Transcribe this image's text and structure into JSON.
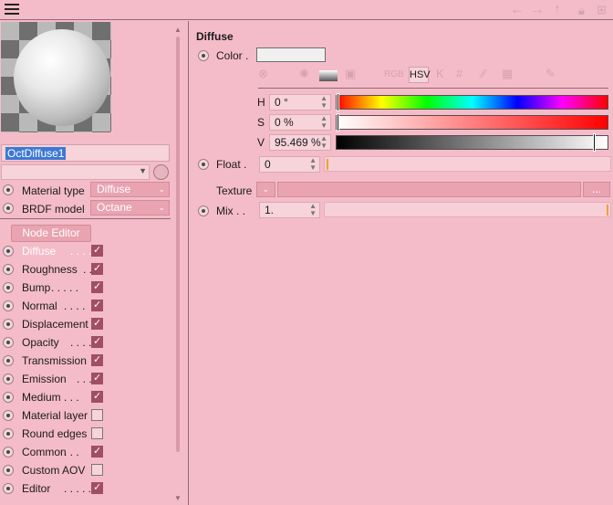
{
  "material_name": "OctDiffuse1",
  "material_type": {
    "label": "Material type",
    "value": "Diffuse"
  },
  "brdf_model": {
    "label": "BRDF model",
    "value": "Octane"
  },
  "node_editor_label": "Node Editor",
  "channels": [
    {
      "label": "Diffuse",
      "dots": ". . . . .",
      "checked": true,
      "active": true
    },
    {
      "label": "Roughness",
      "dots": ". .",
      "checked": true
    },
    {
      "label": "Bump",
      "dots": ". . . . .",
      "checked": true
    },
    {
      "label": "Normal",
      "dots": ". . . .",
      "checked": true
    },
    {
      "label": "Displacement",
      "dots": "",
      "checked": true
    },
    {
      "label": "Opacity",
      "dots": ". . . .",
      "checked": true
    },
    {
      "label": "Transmission",
      "dots": "",
      "checked": true
    },
    {
      "label": "Emission",
      "dots": ". . .",
      "checked": true
    },
    {
      "label": "Medium",
      "dots": ". . .",
      "checked": true
    },
    {
      "label": "Material layer",
      "dots": "",
      "checked": false
    },
    {
      "label": "Round edges",
      "dots": "",
      "checked": false
    },
    {
      "label": "Common",
      "dots": ". . .",
      "checked": true
    },
    {
      "label": "Custom AOV",
      "dots": "",
      "checked": false
    },
    {
      "label": "Editor",
      "dots": ". . . . .",
      "checked": true
    }
  ],
  "diffuse": {
    "title": "Diffuse",
    "color_label": "Color .",
    "hsv_label": "HSV",
    "h": {
      "label": "H",
      "value": "0 °",
      "fraction": 0.0
    },
    "s": {
      "label": "S",
      "value": "0 %",
      "fraction": 0.0
    },
    "v": {
      "label": "V",
      "value": "95.469 %",
      "fraction": 0.955
    },
    "float_label": "Float .",
    "float_value": "0",
    "texture_label": "Texture",
    "texture_browse": "...",
    "mix_label": "Mix . .",
    "mix_value": "1."
  },
  "colors": {
    "background": "#f4bcc8",
    "selection": "#3d78d4",
    "checkbox_on": "#a04f62",
    "accent_marker": "#f0a030"
  }
}
